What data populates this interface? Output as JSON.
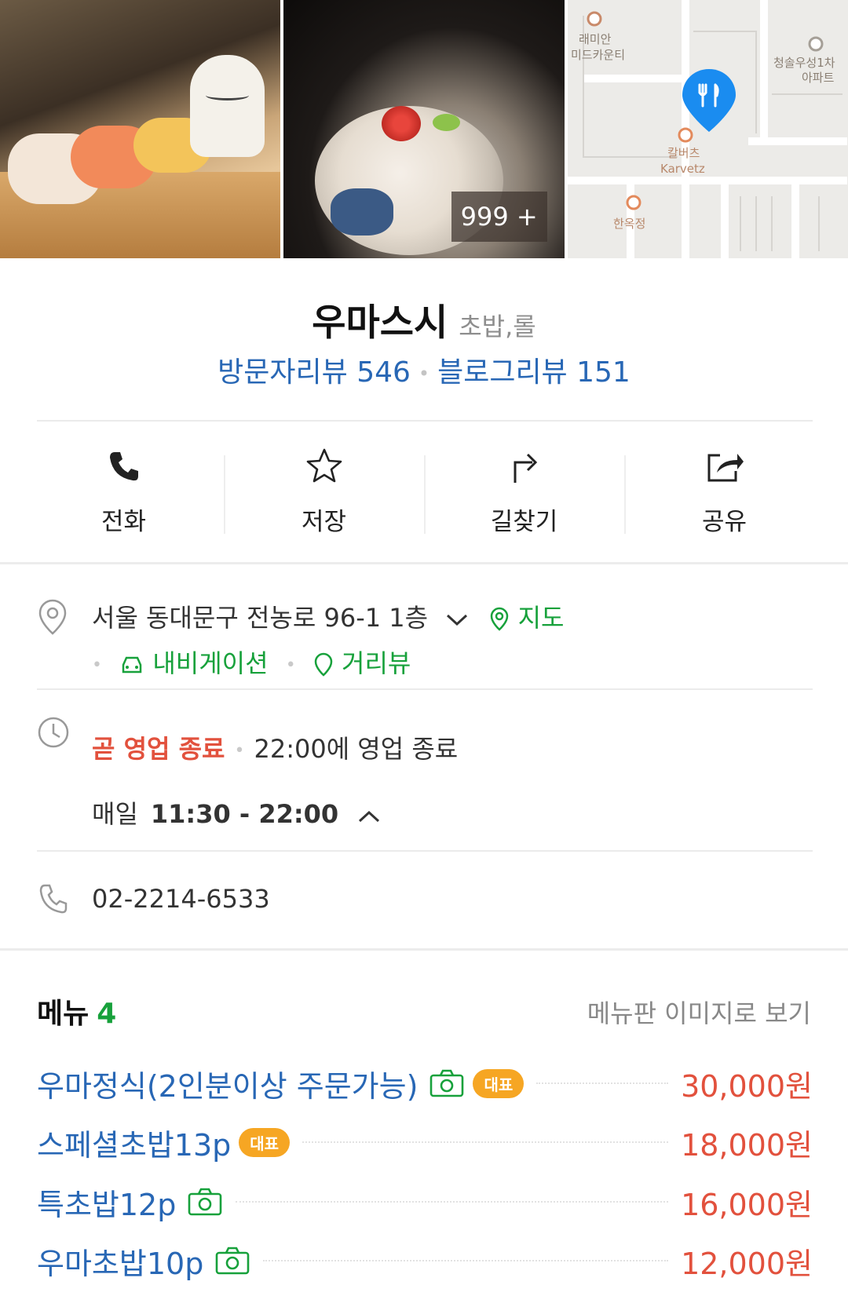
{
  "photos": {
    "count_badge": "999 +",
    "map_labels": [
      "래미안",
      "미드카운티",
      "청솔우성1차",
      "아파트",
      "칼버츠",
      "Karvetz",
      "한옥정"
    ]
  },
  "place": {
    "name": "우마스시",
    "category": "초밥,롤",
    "visitor_reviews": "방문자리뷰 546",
    "blog_reviews": "블로그리뷰 151"
  },
  "actions": [
    {
      "label": "전화",
      "icon": "phone-icon"
    },
    {
      "label": "저장",
      "icon": "star-icon"
    },
    {
      "label": "길찾기",
      "icon": "directions-icon"
    },
    {
      "label": "공유",
      "icon": "share-icon"
    }
  ],
  "address": {
    "text": "서울 동대문구 전농로 96-1 1층",
    "map_link": "지도",
    "navigation_link": "내비게이션",
    "street_view_link": "거리뷰"
  },
  "hours": {
    "status": "곧 영업 종료",
    "closing_note": "22:00에 영업 종료",
    "days": "매일",
    "time": "11:30 - 22:00"
  },
  "phone": "02-2214-6533",
  "menu": {
    "title": "메뉴",
    "count": "4",
    "image_link": "메뉴판 이미지로 보기",
    "representative_label": "대표",
    "items": [
      {
        "name": "우마정식(2인분이상 주문가능)",
        "price": "30,000원",
        "has_photo": true,
        "representative": true
      },
      {
        "name": "스페셜초밥13p",
        "price": "18,000원",
        "has_photo": false,
        "representative": true
      },
      {
        "name": "특초밥12p",
        "price": "16,000원",
        "has_photo": true,
        "representative": false
      },
      {
        "name": "우마초밥10p",
        "price": "12,000원",
        "has_photo": true,
        "representative": false
      }
    ]
  },
  "colors": {
    "link_blue": "#2867b5",
    "green": "#17a13b",
    "red": "#e2513d",
    "badge_orange": "#f6a623",
    "map_pin": "#1a8cf0"
  }
}
